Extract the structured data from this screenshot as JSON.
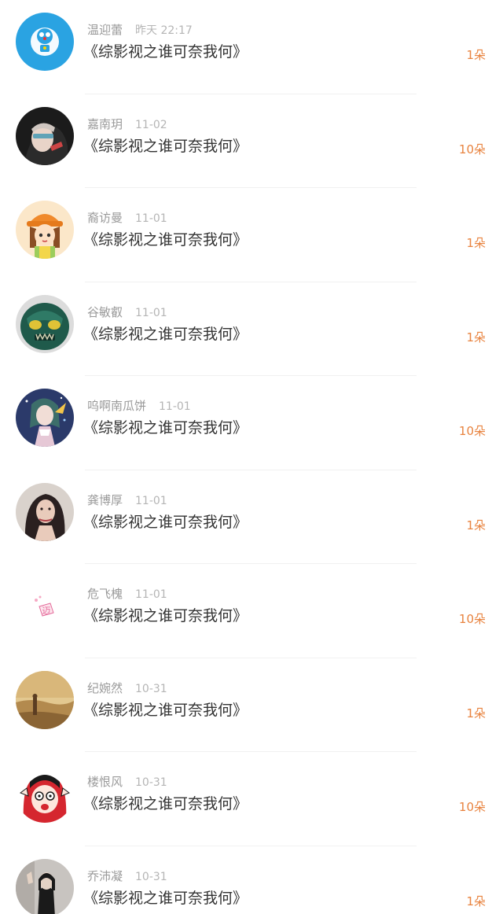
{
  "items": [
    {
      "name": "温迎蕾",
      "time": "昨天 22:17",
      "title": "《综影视之谁可奈我何》",
      "count": "1朵",
      "avatar_icon": "doraemon-avatar-icon",
      "avatar_colors": [
        "#2aa3e2",
        "#ffffff"
      ]
    },
    {
      "name": "嘉南玥",
      "time": "11-02",
      "title": "《综影视之谁可奈我何》",
      "count": "10朵",
      "avatar_icon": "girl-dark-avatar-icon",
      "avatar_colors": [
        "#1b1b1b",
        "#e8d4c8"
      ]
    },
    {
      "name": "裔访曼",
      "time": "11-01",
      "title": "《综影视之谁可奈我何》",
      "count": "1朵",
      "avatar_icon": "cartoon-girl-orange-hat-avatar-icon",
      "avatar_colors": [
        "#fbe7c9",
        "#f08a2c"
      ]
    },
    {
      "name": "谷敏叡",
      "time": "11-01",
      "title": "《综影视之谁可奈我何》",
      "count": "1朵",
      "avatar_icon": "green-monster-avatar-icon",
      "avatar_colors": [
        "#1f5a4b",
        "#e0c236"
      ]
    },
    {
      "name": "呜啊南瓜饼",
      "time": "11-01",
      "title": "《综影视之谁可奈我何》",
      "count": "10朵",
      "avatar_icon": "anime-character-avatar-icon",
      "avatar_colors": [
        "#2b3a6a",
        "#e6c8d6"
      ]
    },
    {
      "name": "龚博厚",
      "time": "11-01",
      "title": "《综影视之谁可奈我何》",
      "count": "1朵",
      "avatar_icon": "woman-portrait-avatar-icon",
      "avatar_colors": [
        "#d9d2cc",
        "#2a2020"
      ]
    },
    {
      "name": "危飞槐",
      "time": "11-01",
      "title": "《综影视之谁可奈我何》",
      "count": "10朵",
      "avatar_icon": "pink-character-avatar-icon",
      "avatar_colors": [
        "#ffffff",
        "#e46a9a"
      ]
    },
    {
      "name": "纪婉然",
      "time": "10-31",
      "title": "《综影视之谁可奈我何》",
      "count": "1朵",
      "avatar_icon": "desert-landscape-avatar-icon",
      "avatar_colors": [
        "#c9a56c",
        "#8a6434"
      ]
    },
    {
      "name": "楼恨风",
      "time": "10-31",
      "title": "《综影视之谁可奈我何》",
      "count": "10朵",
      "avatar_icon": "cartoon-face-avatar-icon",
      "avatar_colors": [
        "#ffffff",
        "#d5262f"
      ]
    },
    {
      "name": "乔沛凝",
      "time": "10-31",
      "title": "《综影视之谁可奈我何》",
      "count": "1朵",
      "avatar_icon": "person-photo-avatar-icon",
      "avatar_colors": [
        "#c8c4c0",
        "#1a1a1a"
      ]
    }
  ]
}
